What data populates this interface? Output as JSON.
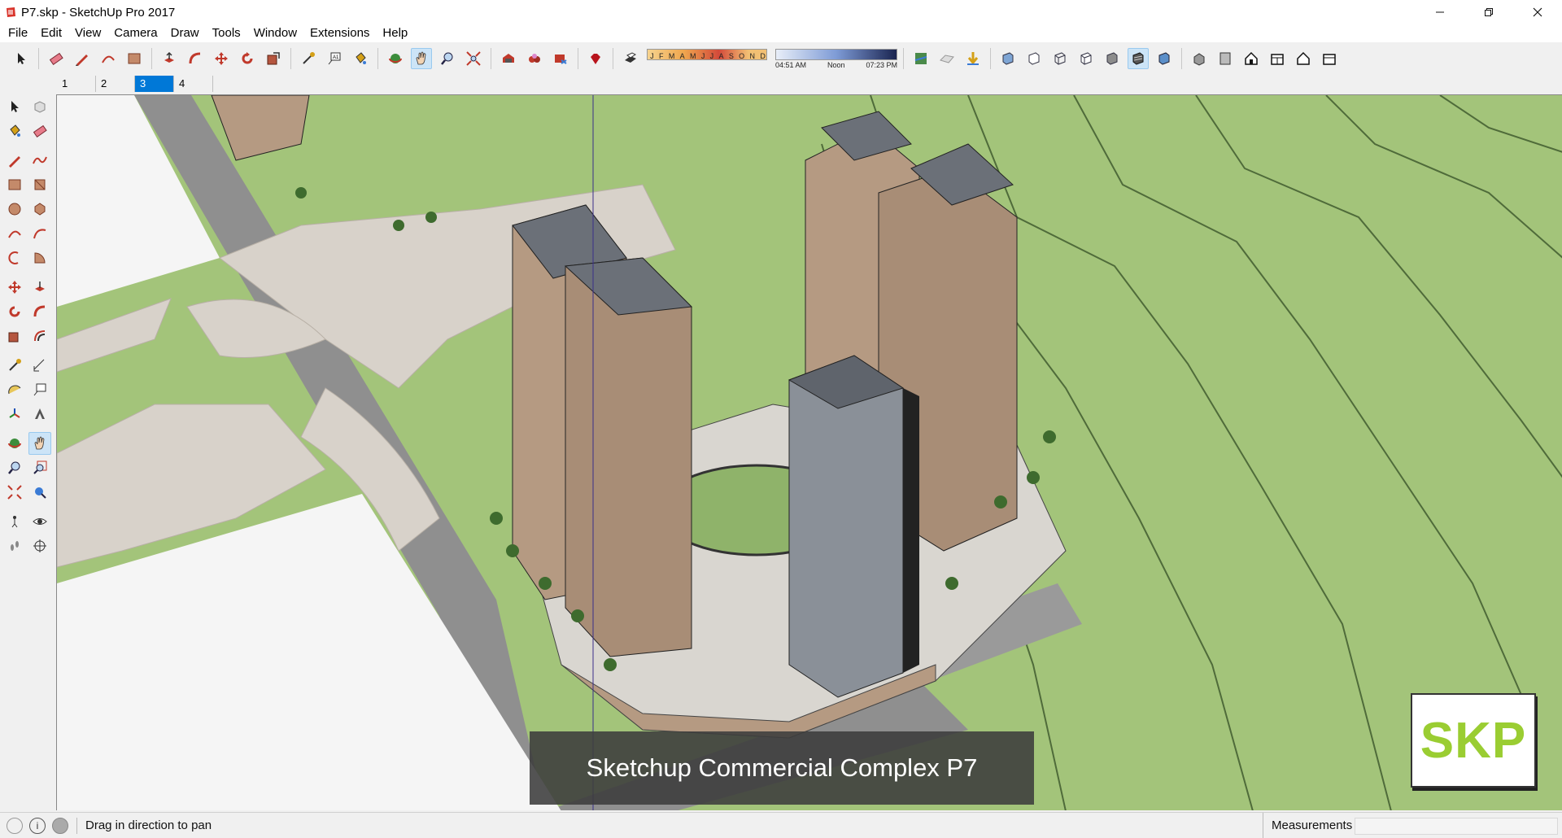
{
  "window": {
    "title": "P7.skp - SketchUp Pro 2017",
    "controls": [
      "minimize-icon",
      "maximize-icon",
      "close-icon"
    ]
  },
  "menu": [
    "File",
    "Edit",
    "View",
    "Camera",
    "Draw",
    "Tools",
    "Window",
    "Extensions",
    "Help"
  ],
  "toolbar": {
    "shadow_months": [
      "J",
      "F",
      "M",
      "A",
      "M",
      "J",
      "J",
      "A",
      "S",
      "O",
      "N",
      "D"
    ],
    "time_start": "04:51 AM",
    "time_noon": "Noon",
    "time_end": "07:23 PM",
    "active_tool": "pan-icon"
  },
  "scenes": {
    "tabs": [
      "1",
      "2",
      "3",
      "4"
    ],
    "active_index": 2
  },
  "viewport": {
    "caption": "Sketchup Commercial Complex P7",
    "logo_text": "SKP",
    "colors": {
      "grass": "#a3c47a",
      "paving": "#d8d2ca",
      "road": "#8f8f8f",
      "building_facade": "#b59a82",
      "glass": "#6b7078"
    }
  },
  "statusbar": {
    "hint": "Drag in direction to pan",
    "measurements_label": "Measurements",
    "measurements_value": ""
  }
}
